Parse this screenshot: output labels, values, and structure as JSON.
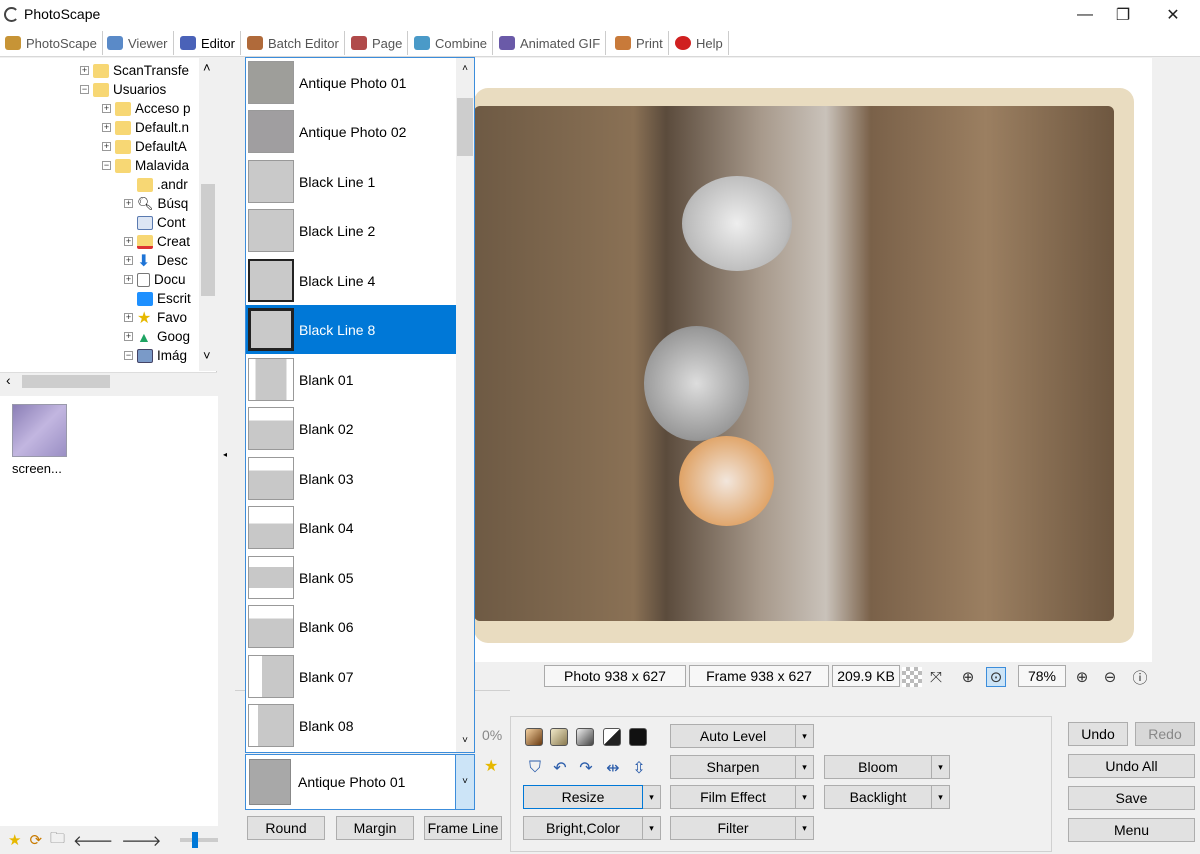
{
  "window": {
    "title": "PhotoScape",
    "minimize": "—",
    "maximize": "❐",
    "close": "✕"
  },
  "tabs": [
    {
      "label": "PhotoScape",
      "color": "#c79436"
    },
    {
      "label": "Viewer",
      "color": "#5a8ac8"
    },
    {
      "label": "Editor",
      "color": "#4a62b8"
    },
    {
      "label": "Batch Editor",
      "color": "#b06a3a"
    },
    {
      "label": "Page",
      "color": "#b04a4a"
    },
    {
      "label": "Combine",
      "color": "#4a9ac8"
    },
    {
      "label": "Animated GIF",
      "color": "#6a5aa8"
    },
    {
      "label": "Print",
      "color": "#c87a3a"
    },
    {
      "label": "Help",
      "color": "#d02020"
    }
  ],
  "tree": {
    "items": [
      {
        "label": "ScanTransfe",
        "expand": "+",
        "type": "folder"
      },
      {
        "label": "Usuarios",
        "expand": "−",
        "type": "folder"
      },
      {
        "label": "Acceso p",
        "expand": "+",
        "type": "folder"
      },
      {
        "label": "Default.n",
        "expand": "+",
        "type": "folder"
      },
      {
        "label": "DefaultA",
        "expand": "+",
        "type": "folder"
      },
      {
        "label": "Malavida",
        "expand": "−",
        "type": "folder"
      },
      {
        "label": ".andr",
        "expand": "",
        "type": "folder"
      },
      {
        "label": "Búsq",
        "expand": "+",
        "type": "search"
      },
      {
        "label": "Cont",
        "expand": "",
        "type": "contact"
      },
      {
        "label": "Creat",
        "expand": "+",
        "type": "create"
      },
      {
        "label": "Desc",
        "expand": "+",
        "type": "download"
      },
      {
        "label": "Docu",
        "expand": "+",
        "type": "doc"
      },
      {
        "label": "Escrit",
        "expand": "",
        "type": "desktop"
      },
      {
        "label": "Favo",
        "expand": "+",
        "type": "star"
      },
      {
        "label": "Goog",
        "expand": "+",
        "type": "drive"
      },
      {
        "label": "Imág",
        "expand": "−",
        "type": "image"
      }
    ]
  },
  "thumbnails": [
    {
      "label": "screen..."
    }
  ],
  "frames": {
    "list": [
      {
        "label": "Antique Photo 01",
        "style": "antique"
      },
      {
        "label": "Antique Photo 02",
        "style": "antique"
      },
      {
        "label": "Black Line 1",
        "style": "plain"
      },
      {
        "label": "Black Line 2",
        "style": "plain"
      },
      {
        "label": "Black Line 4",
        "style": "dark"
      },
      {
        "label": "Black Line 8",
        "style": "dark",
        "selected": true
      },
      {
        "label": "Blank 01",
        "style": "blank"
      },
      {
        "label": "Blank 02",
        "style": "blank"
      },
      {
        "label": "Blank 03",
        "style": "blank"
      },
      {
        "label": "Blank 04",
        "style": "blank"
      },
      {
        "label": "Blank 05",
        "style": "blank"
      },
      {
        "label": "Blank 06",
        "style": "blank"
      },
      {
        "label": "Blank 07",
        "style": "blank2"
      },
      {
        "label": "Blank 08",
        "style": "blank2"
      }
    ],
    "current": "Antique Photo 01",
    "partial_percent": "0%"
  },
  "status": {
    "photo_size": "Photo 938 x 627",
    "frame_size": "Frame 938 x 627",
    "file_size": "209.9 KB",
    "zoom": "78%"
  },
  "frame_buttons": {
    "round": "Round",
    "margin": "Margin",
    "frame_line": "Frame Line"
  },
  "tools": {
    "auto_level": "Auto Level",
    "sharpen": "Sharpen",
    "film_effect": "Film Effect",
    "filter": "Filter",
    "resize": "Resize",
    "bright_color": "Bright,Color",
    "bloom": "Bloom",
    "backlight": "Backlight"
  },
  "actions": {
    "undo": "Undo",
    "redo": "Redo",
    "undo_all": "Undo All",
    "save": "Save",
    "menu": "Menu"
  },
  "icons": {
    "arrow_down": "▾",
    "arrow_up": "▴",
    "arrow_left": "◂",
    "chevron_up": "˄",
    "chevron_down": "˅",
    "chevron_left": "‹"
  }
}
